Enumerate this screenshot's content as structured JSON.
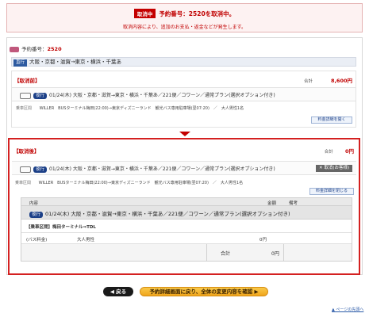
{
  "alert": {
    "tag": "取消中",
    "title": "予約番号：2520を取消中。",
    "message": "取消内容により、追加のお支払・返金などが発生します。"
  },
  "reservation": {
    "label": "予約番号：",
    "number": "2520"
  },
  "route_header": {
    "badge": "直行",
    "text": "大阪・京都・滋賀→東京・横浜・千葉あ"
  },
  "before": {
    "title": "【取消前】",
    "total_label": "合計",
    "total_value": "8,600円",
    "trip_badge": "夜行",
    "trip_text": "01/24(木) 大阪・京都・滋賀→東京・横浜・千葉あ／221便／コワーン／通常プラン(選択オプション付き)",
    "row_label": "乗車区間",
    "row_detail": "WILLER　BUSターミナル梅田(22:00)→東京ディズニーランド　観光バス専用駐車場(翌07:20)　／　大人男性1名",
    "detail_button": "料金詳細を開く"
  },
  "after": {
    "title": "【取消後】",
    "total_label": "合計",
    "total_value": "0円",
    "trip_badge": "夜行",
    "trip_text": "01/24(木) 大阪・京都・滋賀→東京・横浜・千葉あ／221便／コワーン／通常プラン(選択オプション付き)",
    "cancel_mark": "✕ 取消(お客様)",
    "row_label": "乗車区間",
    "row_detail": "WILLER　BUSターミナル梅田(22:00)→東京ディズニーランド　観光バス専用駐車場(翌07:20)　／　大人男性1名",
    "detail_button": "料金詳細を閉じる",
    "table": {
      "col_content": "内容",
      "col_amount": "金額",
      "col_note": "備考",
      "route_badge": "夜行",
      "route_text": "01/24(木) 大阪・京都・滋賀→東京・横浜・千葉あ／221便／コワーン／通常プラン(選択オプション付き)",
      "section_label": "【乗車区間】梅田ターミナル⇒TDL",
      "fare_label": "(バス料金)",
      "fare_desc": "大人男性",
      "fare_amount": "0円",
      "sum_label": "合計",
      "sum_amount": "0円"
    }
  },
  "buttons": {
    "back": "◀ 戻る",
    "confirm": "予約詳細画面に戻り、全体の変更内容を確認 ▶"
  },
  "page_top": "▲ ページの先頭へ"
}
